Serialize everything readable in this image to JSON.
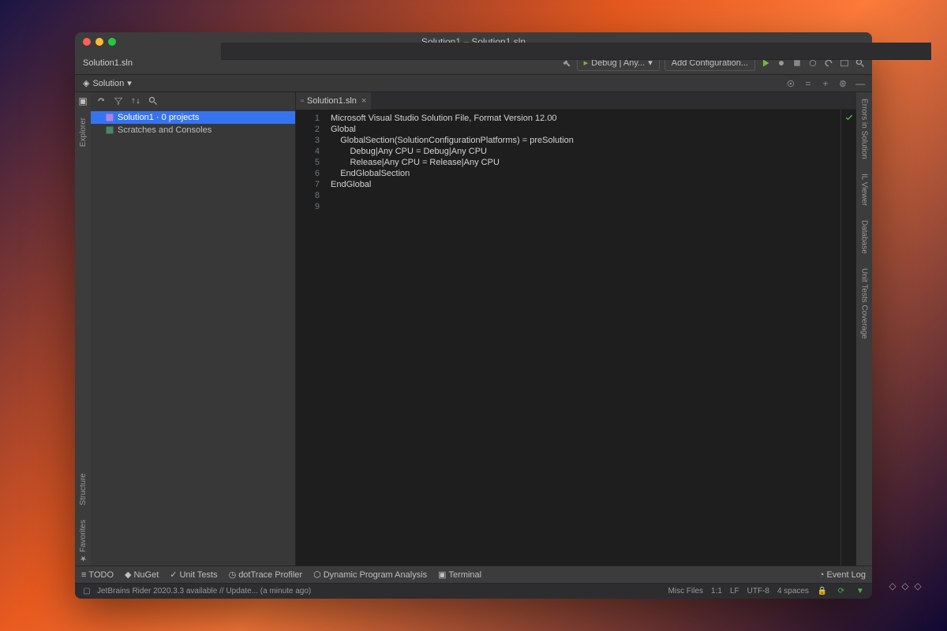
{
  "title": "Solution1 – Solution1.sln",
  "tab_file": "Solution1.sln",
  "solution_label": "Solution",
  "run_config": "Debug | Any...",
  "add_config": "Add Configuration...",
  "explorer": {
    "items": [
      {
        "label": "Solution1 · 0 projects",
        "selected": true
      },
      {
        "label": "Scratches and Consoles",
        "selected": false
      }
    ]
  },
  "editor": {
    "open_tab": "Solution1.sln",
    "lines": [
      "Microsoft Visual Studio Solution File, Format Version 12.00",
      "Global",
      "    GlobalSection(SolutionConfigurationPlatforms) = preSolution",
      "        Debug|Any CPU = Debug|Any CPU",
      "        Release|Any CPU = Release|Any CPU",
      "    EndGlobalSection",
      "EndGlobal",
      ""
    ]
  },
  "left_rail": [
    "Explorer",
    "Structure",
    "Favorites"
  ],
  "right_rail": [
    "Errors in Solution",
    "IL Viewer",
    "Database",
    "Unit Tests Coverage"
  ],
  "bottom": [
    "TODO",
    "NuGet",
    "Unit Tests",
    "dotTrace Profiler",
    "Dynamic Program Analysis",
    "Terminal"
  ],
  "event_log": "Event Log",
  "status": {
    "left": "JetBrains Rider 2020.3.3 available // Update... (a minute ago)",
    "right": [
      "Misc Files",
      "1:1",
      "LF",
      "UTF-8",
      "4 spaces"
    ]
  }
}
